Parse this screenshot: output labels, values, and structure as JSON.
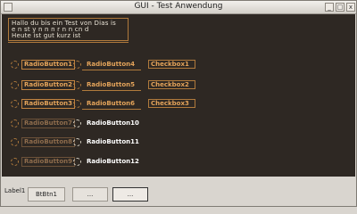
{
  "window": {
    "title": "GUI - Test Anwendung"
  },
  "titlebar": {
    "minimize": "_",
    "maximize": "□",
    "close": "x"
  },
  "textbox": {
    "lines": [
      "Hallo du bis ein Test von Dias is",
      "e n st y n n n r n n cn d",
      "Heute ist gut kurz ist"
    ]
  },
  "radios": {
    "r1": "RadioButton1",
    "r2": "RadioButton2",
    "r3": "RadioButton3",
    "r4": "RadioButton4",
    "r5": "RadioButton5",
    "r6": "RadioButton6",
    "r7": "RadioButton7",
    "r8": "RadioButton8",
    "r9": "RadioButton9",
    "r10": "RadioButton10",
    "r11": "RadioButton11",
    "r12": "RadioButton12"
  },
  "checks": {
    "c1": "Checkbox1",
    "c2": "Checkbox2",
    "c3": "Checkbox3"
  },
  "bottom": {
    "label": "Label1",
    "button1": "BtBtn1",
    "button2": "...",
    "button3": "..."
  },
  "colors": {
    "accent": "#e3a35a",
    "background": "#2e2823",
    "chrome": "#d9d5cf"
  }
}
